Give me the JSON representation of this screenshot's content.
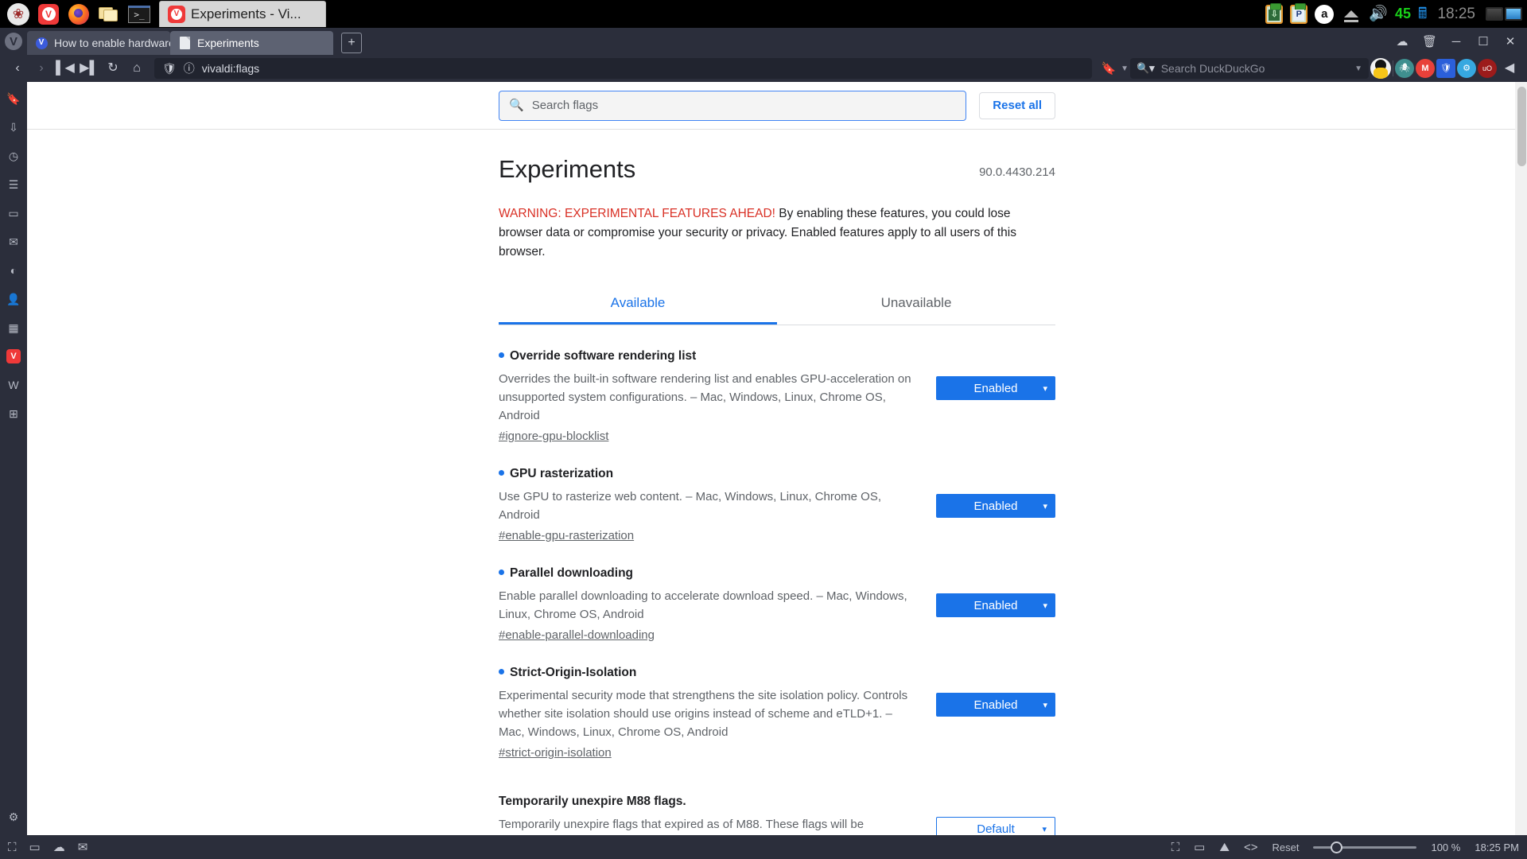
{
  "os_taskbar": {
    "launcher_items": [
      {
        "name": "raspberry-menu",
        "glyph": "❀"
      },
      {
        "name": "vivaldi-launcher",
        "glyph": "V"
      },
      {
        "name": "firefox-launcher",
        "glyph": ""
      },
      {
        "name": "file-manager-launcher",
        "glyph": ""
      },
      {
        "name": "terminal-launcher",
        "glyph": ">_"
      }
    ],
    "window_button": {
      "title": "Experiments - Vi...",
      "icon": "V"
    },
    "tray": {
      "clipboard_download_label": "",
      "clipboard_p_label": "P",
      "amazon_label": "a",
      "volume_level": "45",
      "clock": "18:25"
    }
  },
  "browser": {
    "tabs": [
      {
        "label": "How to enable hardware a",
        "favicon": "vivaldi-icon",
        "active": false
      },
      {
        "label": "Experiments",
        "favicon": "document-icon",
        "active": true
      }
    ],
    "new_tab_label": "+",
    "window_controls": {
      "minimize": "─",
      "maximize": "☐",
      "close": "✕"
    },
    "cloud_icon": "cloud-icon",
    "toolbar": {
      "back": "‹",
      "forward": "›",
      "rewind": "⧏|",
      "fastforward": "|⧐",
      "reload": "↻",
      "home": "⌂",
      "shield": "◇",
      "info": "ⓘ",
      "url": "vivaldi:flags",
      "bookmark": "☐",
      "search_engine": "Q",
      "search_placeholder": "Search DuckDuckGo"
    },
    "extensions": [
      {
        "name": "profile-avatar",
        "label": ""
      },
      {
        "name": "ddg-privacy-extension",
        "label": ""
      },
      {
        "name": "gmail-extension",
        "label": "M"
      },
      {
        "name": "bitwarden-extension",
        "label": "U"
      },
      {
        "name": "blue-extension",
        "label": ""
      },
      {
        "name": "ublock-origin-extension",
        "label": "uO"
      }
    ],
    "panel_rail": [
      {
        "name": "bookmarks-panel",
        "glyph": "▭"
      },
      {
        "name": "downloads-panel",
        "glyph": "⤓"
      },
      {
        "name": "history-panel",
        "glyph": "◴"
      },
      {
        "name": "notes-panel",
        "glyph": "☰"
      },
      {
        "name": "window-panel",
        "glyph": "▭"
      },
      {
        "name": "mail-panel",
        "glyph": "✉"
      },
      {
        "name": "feeds-panel",
        "glyph": "◠"
      },
      {
        "name": "contacts-panel",
        "glyph": "☺"
      },
      {
        "name": "calendar-panel",
        "glyph": "☷"
      },
      {
        "name": "vivaldi-web-panel",
        "glyph": "V"
      },
      {
        "name": "wikipedia-web-panel",
        "glyph": "W"
      },
      {
        "name": "add-web-panel",
        "glyph": "+"
      },
      {
        "name": "settings-panel",
        "glyph": "⚙"
      }
    ],
    "statusbar": {
      "left_icons": [
        {
          "name": "capture-page-icon",
          "glyph": "⬚"
        },
        {
          "name": "tiling-icon",
          "glyph": "▭"
        },
        {
          "name": "sync-status-icon",
          "glyph": "☁"
        },
        {
          "name": "mail-status-icon",
          "glyph": "✉"
        }
      ],
      "right_icons": [
        {
          "name": "capture-icon",
          "glyph": "◎"
        },
        {
          "name": "tile-icon",
          "glyph": "▭"
        },
        {
          "name": "images-toggle-icon",
          "glyph": "▲"
        },
        {
          "name": "developer-tools-icon",
          "glyph": "<>"
        }
      ],
      "reset_label": "Reset",
      "zoom_value": "100 %",
      "clock": "18:25 PM"
    }
  },
  "page": {
    "search": {
      "placeholder": "Search flags",
      "value": "",
      "icon": "search-icon"
    },
    "reset_all_label": "Reset all",
    "title": "Experiments",
    "version": "90.0.4430.214",
    "warning_strong": "WARNING: EXPERIMENTAL FEATURES AHEAD!",
    "warning_body": " By enabling these features, you could lose browser data or compromise your security or privacy. Enabled features apply to all users of this browser.",
    "tabs": [
      {
        "label": "Available",
        "selected": true
      },
      {
        "label": "Unavailable",
        "selected": false
      }
    ],
    "flags": [
      {
        "name": "Override software rendering list",
        "description": "Overrides the built-in software rendering list and enables GPU-acceleration on unsupported system configurations. – Mac, Windows, Linux, Chrome OS, Android",
        "id": "#ignore-gpu-blocklist",
        "state": "Enabled",
        "modified": true
      },
      {
        "name": "GPU rasterization",
        "description": "Use GPU to rasterize web content. – Mac, Windows, Linux, Chrome OS, Android",
        "id": "#enable-gpu-rasterization",
        "state": "Enabled",
        "modified": true
      },
      {
        "name": "Parallel downloading",
        "description": "Enable parallel downloading to accelerate download speed. – Mac, Windows, Linux, Chrome OS, Android",
        "id": "#enable-parallel-downloading",
        "state": "Enabled",
        "modified": true
      },
      {
        "name": "Strict-Origin-Isolation",
        "description": "Experimental security mode that strengthens the site isolation policy. Controls whether site isolation should use origins instead of scheme and eTLD+1. – Mac, Windows, Linux, Chrome OS, Android",
        "id": "#strict-origin-isolation",
        "state": "Enabled",
        "modified": true
      },
      {
        "name": "Temporarily unexpire M88 flags.",
        "description": "Temporarily unexpire flags that expired as of M88. These flags will be",
        "id": "",
        "state": "Default",
        "modified": false
      }
    ],
    "colors": {
      "accent": "#1a73e8",
      "warning": "#d93025",
      "text": "#202124",
      "muted": "#5f6368"
    }
  }
}
